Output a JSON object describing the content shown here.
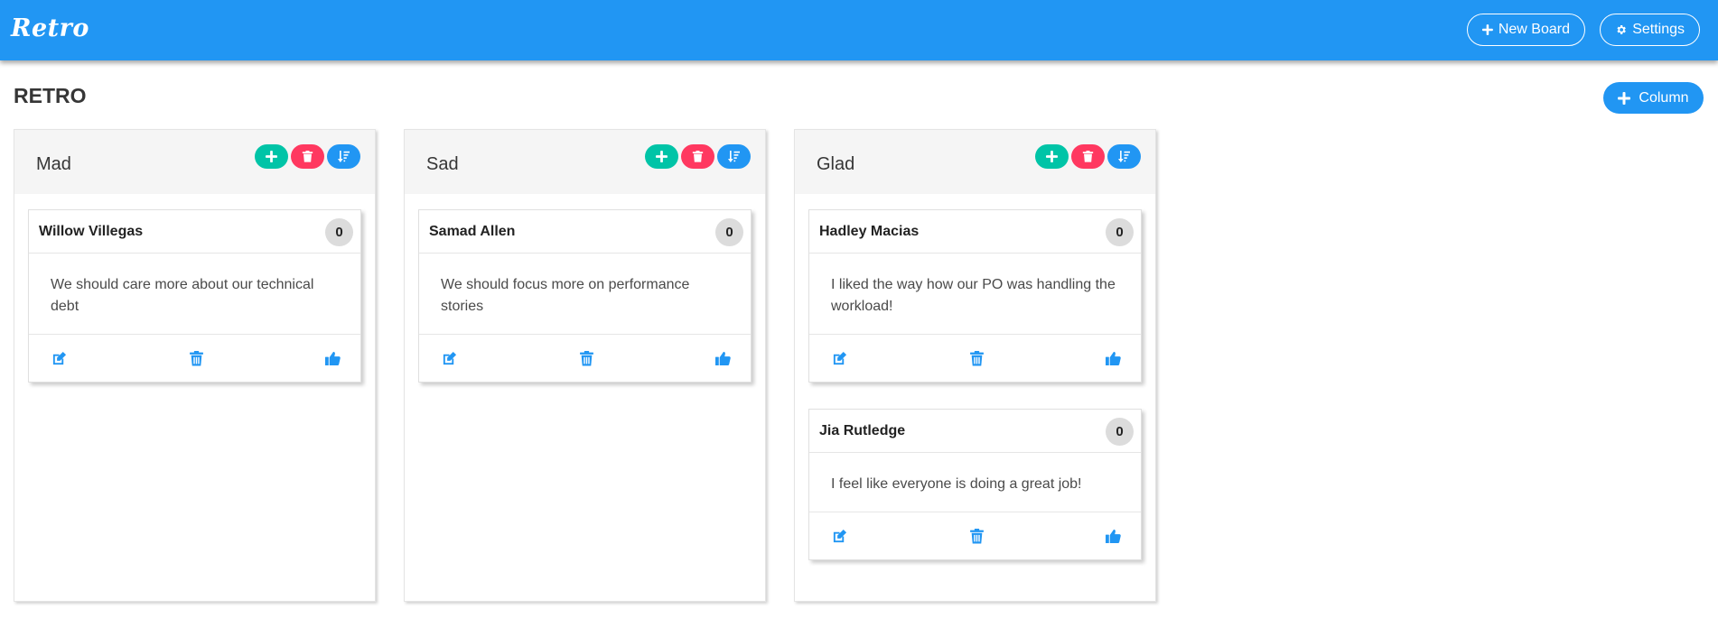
{
  "navbar": {
    "brand": "Retro",
    "new_board_label": "New Board",
    "settings_label": "Settings"
  },
  "page": {
    "title": "RETRO",
    "add_column_label": "Column"
  },
  "colors": {
    "primary": "#2196f3",
    "add": "#00c4a7",
    "delete": "#ff3860"
  },
  "columns": [
    {
      "title": "Mad",
      "cards": [
        {
          "author": "Willow Villegas",
          "votes": "0",
          "text": "We should care more about our technical debt"
        }
      ]
    },
    {
      "title": "Sad",
      "cards": [
        {
          "author": "Samad Allen",
          "votes": "0",
          "text": "We should focus more on performance stories"
        }
      ]
    },
    {
      "title": "Glad",
      "cards": [
        {
          "author": "Hadley Macias",
          "votes": "0",
          "text": "I liked the way how our PO was handling the workload!"
        },
        {
          "author": "Jia Rutledge",
          "votes": "0",
          "text": "I feel like everyone is doing a great job!"
        }
      ]
    }
  ],
  "icons": {
    "column_actions": [
      "plus-icon",
      "trash-icon",
      "sort-icon"
    ],
    "card_actions": [
      "edit-icon",
      "trash-icon",
      "thumbs-up-icon"
    ]
  }
}
